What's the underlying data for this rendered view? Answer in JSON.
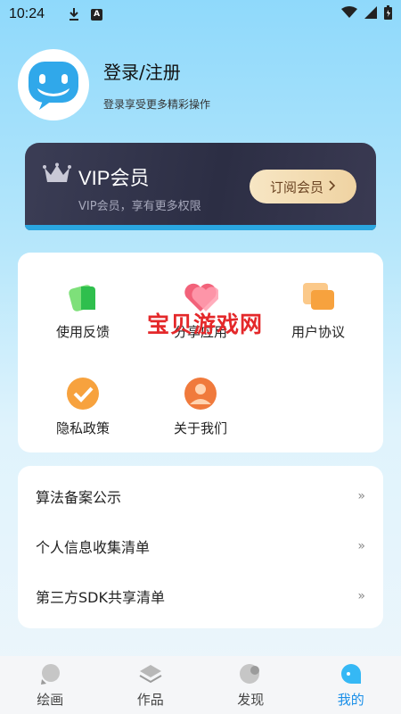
{
  "status_bar": {
    "time": "10:24"
  },
  "profile": {
    "title": "登录/注册",
    "subtitle": "登录享受更多精彩操作"
  },
  "vip": {
    "title": "VIP会员",
    "subtitle": "VIP会员，享有更多权限",
    "button_label": "订阅会员"
  },
  "grid": {
    "items": [
      {
        "label": "使用反馈",
        "icon": "feedback-icon"
      },
      {
        "label": "分享应用",
        "icon": "heart-icon"
      },
      {
        "label": "用户协议",
        "icon": "chat-icon"
      },
      {
        "label": "隐私政策",
        "icon": "shield-check-icon"
      },
      {
        "label": "关于我们",
        "icon": "person-icon"
      }
    ],
    "watermark": "宝贝游戏网"
  },
  "list": {
    "items": [
      {
        "label": "算法备案公示"
      },
      {
        "label": "个人信息收集清单"
      },
      {
        "label": "第三方SDK共享清单"
      }
    ],
    "chevron": "»"
  },
  "nav": {
    "items": [
      {
        "label": "绘画"
      },
      {
        "label": "作品"
      },
      {
        "label": "发现"
      },
      {
        "label": "我的"
      }
    ],
    "active_color": "#1a8fe8"
  }
}
